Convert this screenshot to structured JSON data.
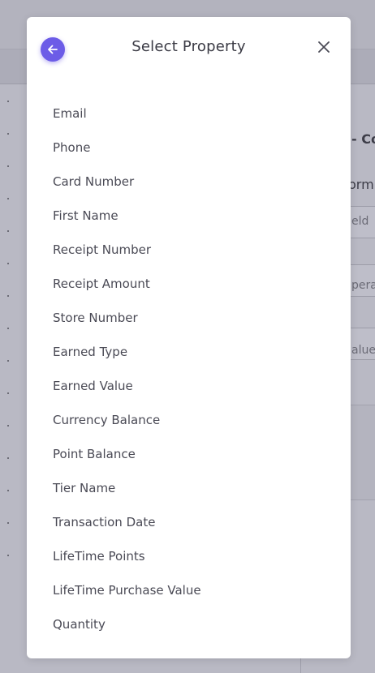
{
  "modal": {
    "title": "Select Property",
    "back_icon": "arrow-left-icon",
    "close_icon": "close-icon",
    "accent_color": "#6c5ce7",
    "properties": [
      "Email",
      "Phone",
      "Card Number",
      "First Name",
      "Receipt Number",
      "Receipt Amount",
      "Store Number",
      "Earned Type",
      "Earned Value",
      "Currency Balance",
      "Point Balance",
      "Tier Name",
      "Transaction Date",
      "LifeTime Points",
      "LifeTime Purchase Value",
      "Quantity"
    ]
  },
  "background": {
    "title_fragment": "- Co",
    "subtitle_fragment": "orm",
    "field_label_fragment": "eld",
    "operator_label_fragment": "pera",
    "value_label_fragment": "alue"
  }
}
